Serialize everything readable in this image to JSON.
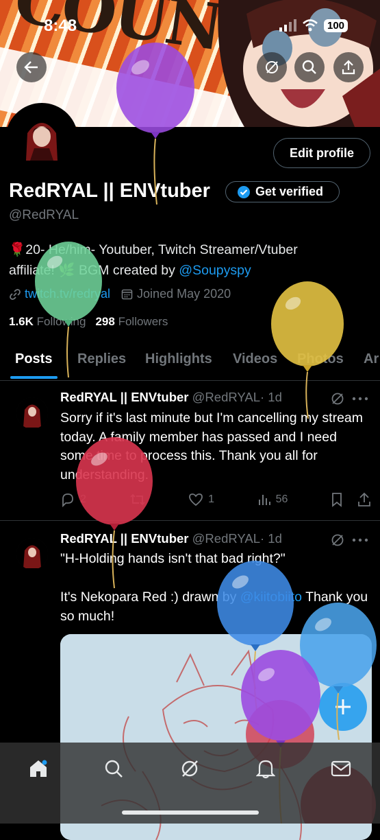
{
  "status_bar": {
    "time": "8:48",
    "battery": "100"
  },
  "banner": {
    "art_text": "COUNTER"
  },
  "profile": {
    "display_name": "RedRYAL || ENVtuber",
    "handle": "@RedRYAL",
    "edit_profile_label": "Edit profile",
    "get_verified_label": "Get verified",
    "bio": {
      "line1_emoji": "🌹",
      "line1": "20- He/him- Youtuber, Twitch Streamer/Vtuber",
      "line2_prefix": "affiliate! ",
      "line2_emoji": "🌿",
      "line2_text": " BGM created by ",
      "line2_link": "@Soupyspy"
    },
    "website": "twitch.tv/redryal",
    "joined": "Joined May 2020",
    "following_count": "1.6K",
    "following_label": "Following",
    "followers_count": "298",
    "followers_label": "Followers"
  },
  "tabs": [
    "Posts",
    "Replies",
    "Highlights",
    "Videos",
    "Photos",
    "Ar"
  ],
  "tweets": [
    {
      "name": "RedRYAL || ENVtuber",
      "handle": "@RedRYAL",
      "time": "· 1d",
      "text": "Sorry if it's last minute but I'm cancelling my stream today. A family member has passed and I need some time to process this. Thank you all for understanding.",
      "replies": "2",
      "likes": "1",
      "views": "56"
    },
    {
      "name": "RedRYAL || ENVtuber",
      "handle": "@RedRYAL",
      "time": "· 1d",
      "text_line1": "\"H-Holding hands isn't that bad right?\"",
      "text_line2_prefix": "It's Nekopara Red :) drawn by ",
      "text_line2_link": "@kiitobiito",
      "text_line2_suffix": " Thank you so much!"
    }
  ],
  "colors": {
    "accent": "#1d9bf0",
    "background": "#000000",
    "muted": "#71767b"
  },
  "icons": [
    "back-arrow-icon",
    "grok-icon",
    "search-icon",
    "share-icon",
    "verified-badge-icon",
    "link-icon",
    "calendar-icon",
    "more-icon",
    "reply-icon",
    "retweet-icon",
    "like-icon",
    "views-icon",
    "bookmark-icon",
    "plus-icon",
    "home-icon",
    "bell-icon",
    "mail-icon"
  ]
}
